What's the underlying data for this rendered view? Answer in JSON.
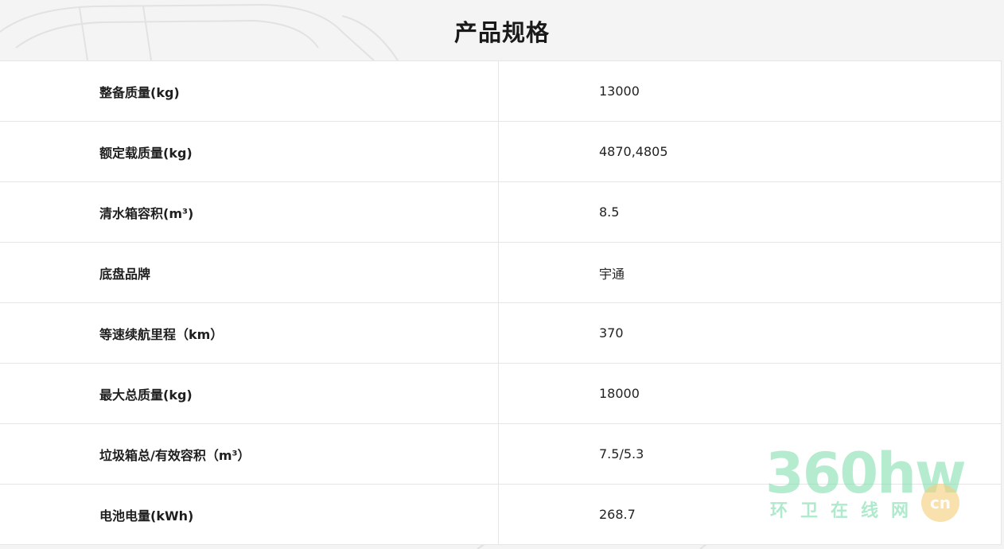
{
  "header": {
    "title": "产品规格"
  },
  "specs": [
    {
      "label": "整备质量(kg)",
      "value": "13000"
    },
    {
      "label": "额定载质量(kg)",
      "value": "4870,4805"
    },
    {
      "label": "清水箱容积(m³)",
      "value": "8.5"
    },
    {
      "label": "底盘品牌",
      "value": "宇通"
    },
    {
      "label": "等速续航里程（km）",
      "value": "370"
    },
    {
      "label": "最大总质量(kg)",
      "value": "18000"
    },
    {
      "label": "垃圾箱总/有效容积（m³）",
      "value": "7.5/5.3"
    },
    {
      "label": "电池电量(kWh)",
      "value": "268.7"
    }
  ],
  "watermark": {
    "main": "360hw",
    "sub": "环卫在线网",
    "badge": "cn",
    "color": "#78dcaa"
  }
}
